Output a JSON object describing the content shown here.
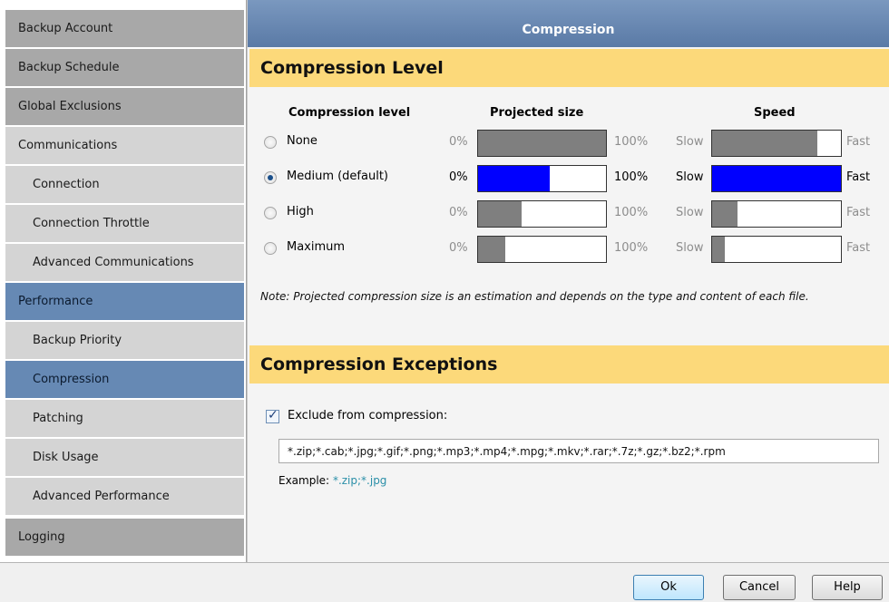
{
  "sidebar": {
    "items": [
      {
        "label": "Backup Account"
      },
      {
        "label": "Backup Schedule"
      },
      {
        "label": "Global Exclusions"
      },
      {
        "label": "Communications"
      },
      {
        "label": "Connection"
      },
      {
        "label": "Connection Throttle"
      },
      {
        "label": "Advanced Communications"
      },
      {
        "label": "Performance"
      },
      {
        "label": "Backup Priority"
      },
      {
        "label": "Compression"
      },
      {
        "label": "Patching"
      },
      {
        "label": "Disk Usage"
      },
      {
        "label": "Advanced Performance"
      },
      {
        "label": "Logging"
      }
    ]
  },
  "panel": {
    "title": "Compression"
  },
  "compression_level": {
    "heading": "Compression Level",
    "columns": {
      "level": "Compression level",
      "size": "Projected size",
      "speed": "Speed"
    },
    "size_min_label": "0%",
    "size_max_label": "100%",
    "speed_min_label": "Slow",
    "speed_max_label": "Fast",
    "options": [
      {
        "label": "None",
        "selected": false,
        "projected_size": 1.0,
        "speed": 0.82
      },
      {
        "label": "Medium (default)",
        "selected": true,
        "projected_size": 0.56,
        "speed": 1.0
      },
      {
        "label": "High",
        "selected": false,
        "projected_size": 0.34,
        "speed": 0.2
      },
      {
        "label": "Maximum",
        "selected": false,
        "projected_size": 0.21,
        "speed": 0.1
      }
    ],
    "note": "Note: Projected compression size is an estimation and depends on the type and content of each file."
  },
  "compression_exceptions": {
    "heading": "Compression Exceptions",
    "exclude_label": "Exclude from compression:",
    "exclude_checked": true,
    "exceptions_value": "*.zip;*.cab;*.jpg;*.gif;*.png;*.mp3;*.mp4;*.mpg;*.mkv;*.rar;*.7z;*.gz;*.bz2;*.rpm",
    "example_label": "Example:",
    "example_value": "*.zip;*.jpg"
  },
  "footer": {
    "ok_label": "Ok",
    "cancel_label": "Cancel",
    "help_label": "Help"
  },
  "colors": {
    "selected_fill": "#0000ff",
    "unselected_fill": "#7f7f7f",
    "section_bar": "#fcd97a",
    "sidebar_selected": "#6689b4"
  }
}
